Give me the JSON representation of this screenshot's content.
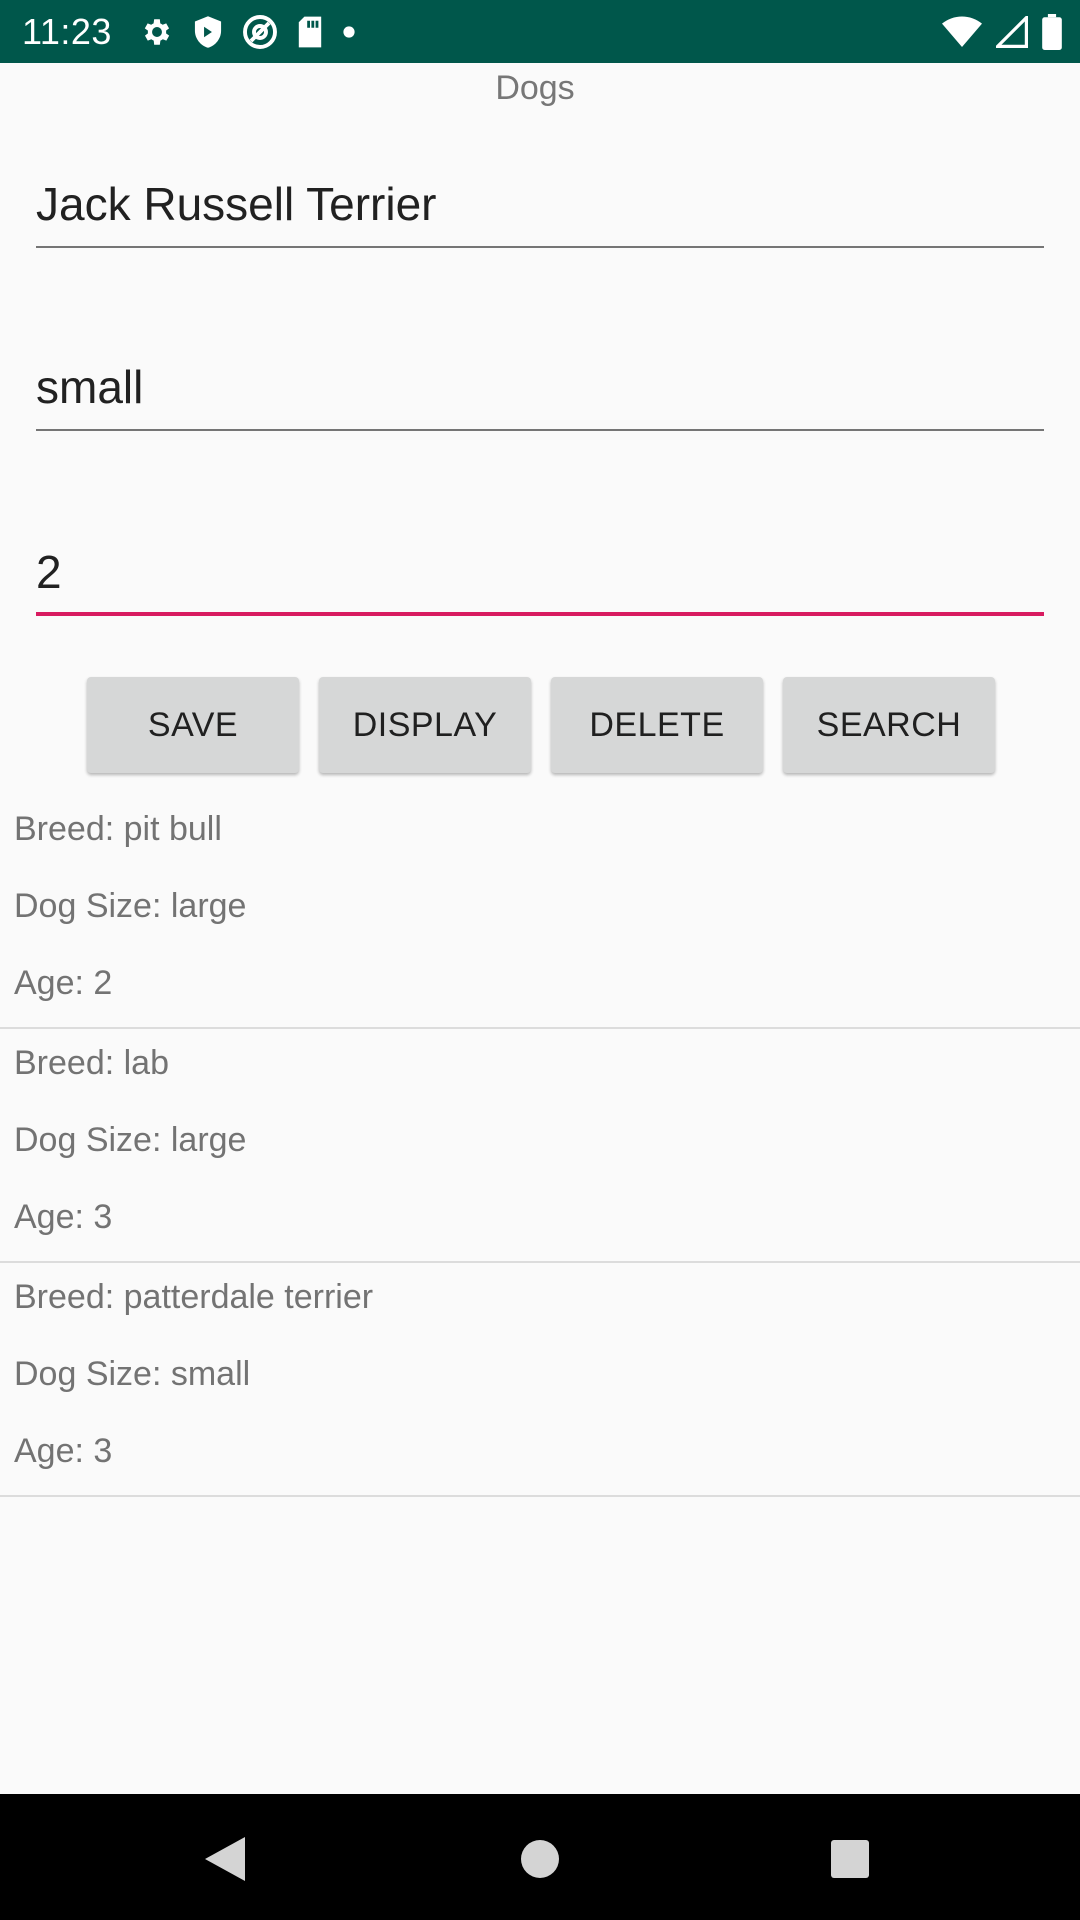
{
  "status_bar": {
    "time": "11:23",
    "left_icons": [
      "gear-icon",
      "shield-icon",
      "at-sign-icon",
      "sd-card-icon",
      "dot-icon"
    ],
    "right_icons": [
      "wifi-icon",
      "signal-icon",
      "battery-icon"
    ]
  },
  "app": {
    "title": "Dogs"
  },
  "form": {
    "breed_value": "Jack Russell Terrier",
    "size_value": "small",
    "age_value": "2",
    "accent_color": "#d81b60"
  },
  "buttons": {
    "save": "SAVE",
    "display": "DISPLAY",
    "delete": "DELETE",
    "search": "SEARCH"
  },
  "dogs": [
    {
      "breed": "Breed: pit bull",
      "size": "Dog Size: large",
      "age": "Age: 2"
    },
    {
      "breed": "Breed: lab",
      "size": "Dog Size: large",
      "age": "Age: 3"
    },
    {
      "breed": "Breed: patterdale terrier",
      "size": "Dog Size: small",
      "age": "Age: 3"
    }
  ],
  "nav": {
    "icons": [
      "back-icon",
      "home-icon",
      "recents-icon"
    ]
  }
}
